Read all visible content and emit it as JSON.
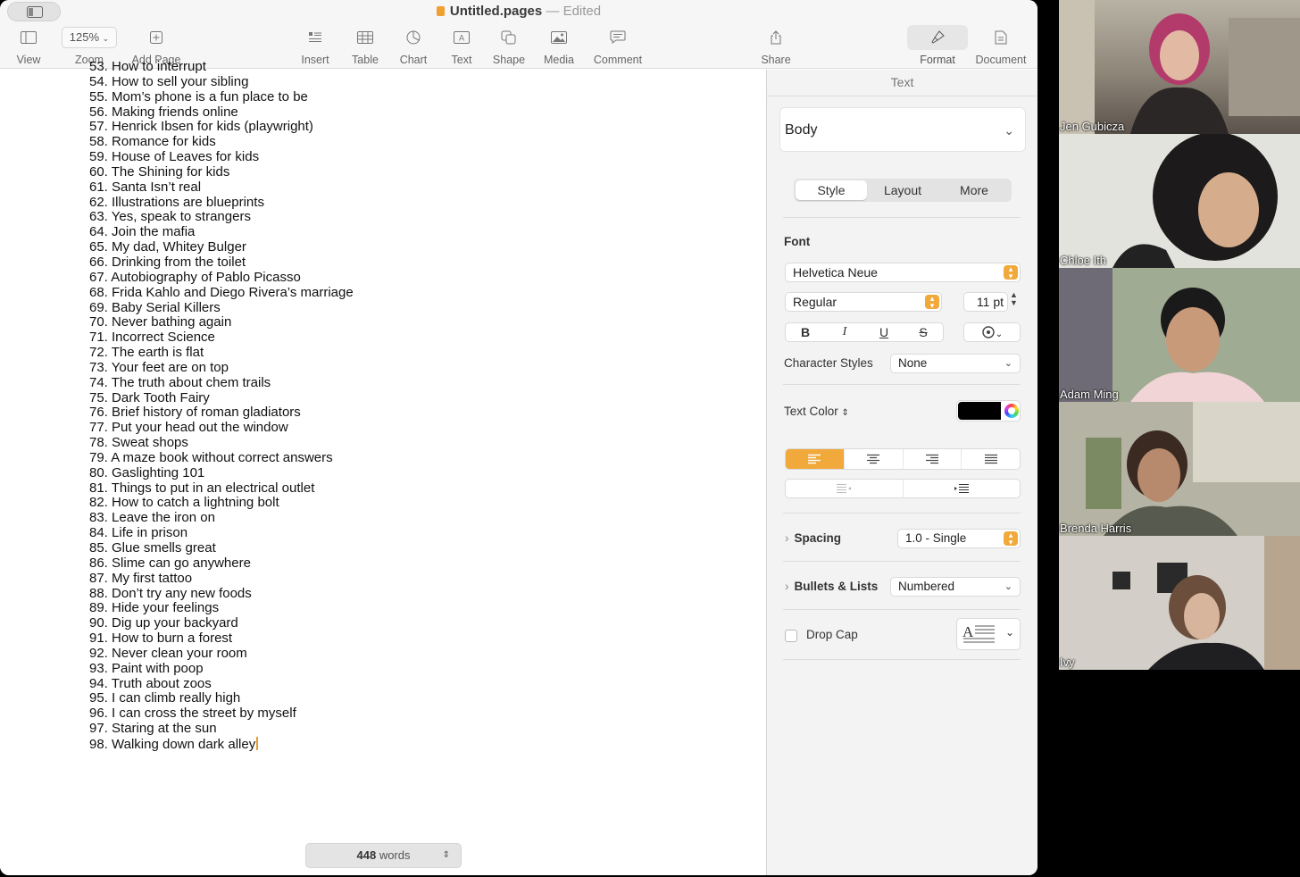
{
  "window": {
    "title": "Untitled.pages",
    "separator": "—",
    "status": "Edited"
  },
  "toolbar": {
    "view": "View",
    "zoom_value": "125%",
    "zoom": "Zoom",
    "add_page": "Add Page",
    "insert": "Insert",
    "table": "Table",
    "chart": "Chart",
    "text": "Text",
    "shape": "Shape",
    "media": "Media",
    "comment": "Comment",
    "share": "Share",
    "format": "Format",
    "document": "Document"
  },
  "document": {
    "items": [
      "53. How to interrupt",
      "54. How to sell your sibling",
      "55. Mom’s phone is a fun place to be",
      "56. Making friends online",
      "57. Henrick Ibsen for kids (playwright)",
      "58. Romance for kids",
      "59. House of Leaves for kids",
      "60. The Shining for kids",
      "61. Santa Isn’t real",
      "62. Illustrations are blueprints",
      "63. Yes, speak to strangers",
      "64. Join the mafia",
      "65. My dad, Whitey Bulger",
      "66. Drinking from the toilet",
      "67. Autobiography of Pablo Picasso",
      "68. Frida Kahlo and Diego Rivera’s marriage",
      "69. Baby Serial Killers",
      "70. Never bathing again",
      "71. Incorrect Science",
      "72. The earth is flat",
      "73. Your feet are on top",
      "74. The truth about chem trails",
      "75. Dark Tooth Fairy",
      "76. Brief history of roman gladiators",
      "77. Put your head out the window",
      "78. Sweat shops",
      "79. A maze book without correct answers",
      "80. Gaslighting 101",
      "81. Things to put in an electrical outlet",
      "82. How to catch a lightning bolt",
      "83. Leave the iron on",
      "84. Life in prison",
      "85. Glue smells great",
      "86. Slime can go anywhere",
      "87. My first tattoo",
      "88. Don’t try any new foods",
      "89. Hide your feelings",
      "90. Dig up your backyard",
      "91. How to burn a forest",
      "92. Never clean your room",
      "93. Paint with poop",
      "94. Truth about zoos",
      "95. I can climb really high",
      "96. I can cross the street by myself",
      "97. Staring at the sun",
      "98. Walking down dark alley"
    ],
    "word_count_num": "448",
    "word_count_unit": "words"
  },
  "inspector": {
    "header": "Text",
    "paragraph_style": "Body",
    "tabs": [
      "Style",
      "Layout",
      "More"
    ],
    "font_label": "Font",
    "font_family": "Helvetica Neue",
    "font_typeface": "Regular",
    "font_size": "11 pt",
    "bold": "B",
    "italic": "I",
    "underline": "U",
    "strike": "S",
    "character_styles_label": "Character Styles",
    "character_styles_value": "None",
    "text_color_label": "Text Color",
    "text_color": "#000000",
    "spacing_label": "Spacing",
    "spacing_value": "1.0 - Single",
    "bullets_label": "Bullets & Lists",
    "bullets_value": "Numbered",
    "drop_cap_label": "Drop Cap",
    "accent_color": "#f0a93a"
  },
  "participants": [
    {
      "name": "Jen Gubicza"
    },
    {
      "name": "Chloe Ith"
    },
    {
      "name": "Adam Ming"
    },
    {
      "name": "Brenda Harris"
    },
    {
      "name": "Ivy"
    }
  ]
}
